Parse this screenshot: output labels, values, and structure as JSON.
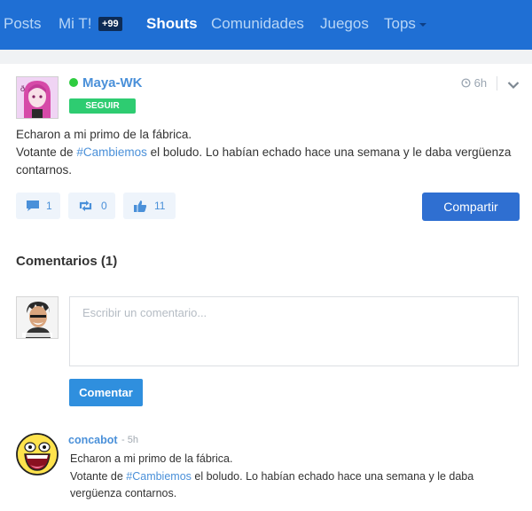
{
  "nav": {
    "items": [
      {
        "label": "Posts"
      },
      {
        "label": "Mi T!"
      },
      {
        "label": "Shouts"
      },
      {
        "label": "Comunidades"
      },
      {
        "label": "Juegos"
      },
      {
        "label": "Tops"
      }
    ],
    "badge": "+99",
    "active": "Shouts"
  },
  "post": {
    "username": "Maya-WK",
    "follow_label": "SEGUIR",
    "time": "6h",
    "text_line1": "Echaron a mi primo de la fábrica.",
    "text_pre": "Votante de ",
    "hashtag": "#Cambiemos",
    "text_post": " el boludo. Lo habían echado hace una semana y le daba vergüenza contarnos.",
    "actions": {
      "comments": "1",
      "reshouts": "0",
      "likes": "11"
    },
    "share_label": "Compartir"
  },
  "comments": {
    "title": "Comentarios (1)",
    "placeholder": "Escribir un comentario...",
    "submit_label": "Comentar",
    "items": [
      {
        "user": "concabot",
        "time": "- 5h",
        "text_line1": "Echaron a mi primo de la fábrica.",
        "text_pre": "Votante de ",
        "hashtag": "#Cambiemos",
        "text_post": " el boludo. Lo habían echado hace una semana y le daba vergüenza contarnos."
      }
    ]
  },
  "colors": {
    "nav_bg": "#1f6fd4",
    "accent": "#4a90d9",
    "follow": "#2ecc71",
    "share": "#2f6fd1"
  }
}
